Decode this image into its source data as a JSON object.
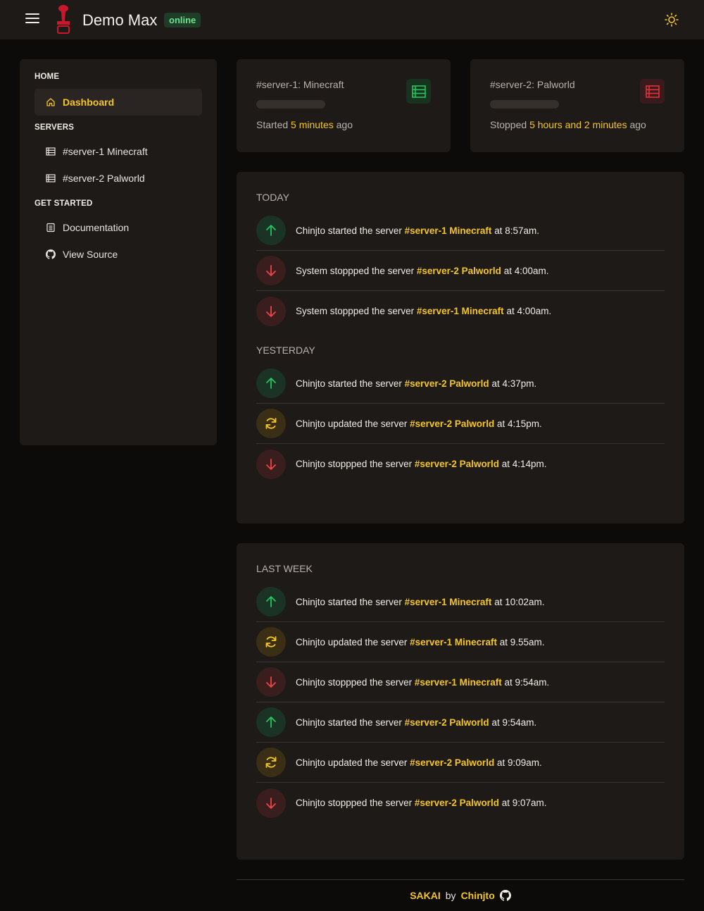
{
  "header": {
    "app_title": "Demo Max",
    "status": "online"
  },
  "sidebar": {
    "sections": [
      {
        "title": "HOME",
        "items": [
          {
            "label": "Dashboard",
            "icon": "home-icon",
            "active": true
          }
        ]
      },
      {
        "title": "SERVERS",
        "items": [
          {
            "label": "#server-1 Minecraft",
            "icon": "server-list-icon"
          },
          {
            "label": "#server-2 Palworld",
            "icon": "server-list-icon"
          }
        ]
      },
      {
        "title": "GET STARTED",
        "items": [
          {
            "label": "Documentation",
            "icon": "book-icon"
          },
          {
            "label": "View Source",
            "icon": "github-icon"
          }
        ]
      }
    ]
  },
  "servers": [
    {
      "name": "#server-1: Minecraft",
      "state_prefix": "Started",
      "duration": "5 minutes",
      "suffix": "ago",
      "color": "#22c55e",
      "bg": "#17321f"
    },
    {
      "name": "#server-2: Palworld",
      "state_prefix": "Stopped",
      "duration": "5 hours and 2 minutes",
      "suffix": "ago",
      "color": "#e0323b",
      "bg": "#3a1b1d"
    }
  ],
  "feeds": [
    {
      "groups": [
        {
          "label": "TODAY",
          "events": [
            {
              "type": "up",
              "prefix": "Chinjto started the server",
              "server": "#server-1 Minecraft",
              "time": "at 8:57am."
            },
            {
              "type": "down",
              "prefix": "System stoppped the server",
              "server": "#server-2 Palworld",
              "time": "at 4:00am."
            },
            {
              "type": "down",
              "prefix": "System stoppped the server",
              "server": "#server-1 Minecraft",
              "time": "at 4:00am."
            }
          ]
        },
        {
          "label": "YESTERDAY",
          "events": [
            {
              "type": "up",
              "prefix": "Chinjto started the server",
              "server": "#server-2 Palworld",
              "time": "at 4:37pm."
            },
            {
              "type": "upd",
              "prefix": "Chinjto updated the server",
              "server": "#server-2 Palworld",
              "time": "at 4:15pm."
            },
            {
              "type": "down",
              "prefix": "Chinjto stoppped the server",
              "server": "#server-2 Palworld",
              "time": "at 4:14pm."
            }
          ]
        }
      ]
    },
    {
      "groups": [
        {
          "label": "LAST WEEK",
          "events": [
            {
              "type": "up",
              "prefix": "Chinjto started the server",
              "server": "#server-1 Minecraft",
              "time": "at 10:02am."
            },
            {
              "type": "upd",
              "prefix": "Chinjto updated the server",
              "server": "#server-1 Minecraft",
              "time": "at 9.55am."
            },
            {
              "type": "down",
              "prefix": "Chinjto stoppped the server",
              "server": "#server-1 Minecraft",
              "time": "at 9:54am."
            },
            {
              "type": "up",
              "prefix": "Chinjto started the server",
              "server": "#server-2 Palworld",
              "time": "at 9:54am."
            },
            {
              "type": "upd",
              "prefix": "Chinjto updated the server",
              "server": "#server-2 Palworld",
              "time": "at 9:09am."
            },
            {
              "type": "down",
              "prefix": "Chinjto stoppped the server",
              "server": "#server-2 Palworld",
              "time": "at 9:07am."
            }
          ]
        }
      ]
    }
  ],
  "footer": {
    "brand": "SAKAI",
    "by": "by",
    "author": "Chinjto",
    "icon": "github-icon"
  },
  "colors": {
    "accent": "#f5c623",
    "up": "#22c55e",
    "down": "#ef4444",
    "update": "#f5c623"
  }
}
